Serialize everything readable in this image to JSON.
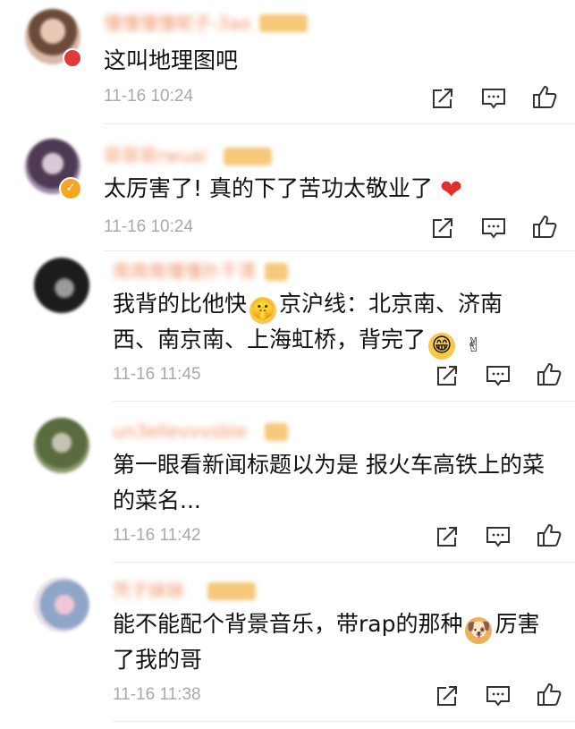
{
  "comments": [
    {
      "username": "懂懂懂懂呢子-3ao",
      "text_lines": [
        "这叫地理图吧"
      ],
      "time": "11-16 10:24"
    },
    {
      "username": "菲菲菲rwuai",
      "text_lines": [
        "太厉害了! 真的下了苦功太敬业了"
      ],
      "time": "11-16 10:24"
    },
    {
      "username": "南南南懂懂扑干渭",
      "text_lines": [
        "我背的比他快",
        "京沪线：北京南、济南",
        "西、南京南、上海虹桥，背完了"
      ],
      "time": "11-16 11:45"
    },
    {
      "username": "un3ellevvvsble",
      "text_lines": [
        "第一眼看新闻标题以为是 报火车高铁上的菜",
        "的菜名..."
      ],
      "time": "11-16 11:42"
    },
    {
      "username": "凭子妹妹",
      "text_lines": [
        "能不能配个背景音乐，带rap的那种",
        "厉害",
        "了我的哥"
      ],
      "time": "11-16 11:38"
    }
  ],
  "icons": {
    "share": "share-icon",
    "reply": "comment-reply-icon",
    "like": "thumbs-up-icon"
  },
  "colors": {
    "timestamp": "#a9a9a9",
    "text": "#111111",
    "heart": "#e0302d",
    "username_blurred": "#f0956a"
  }
}
